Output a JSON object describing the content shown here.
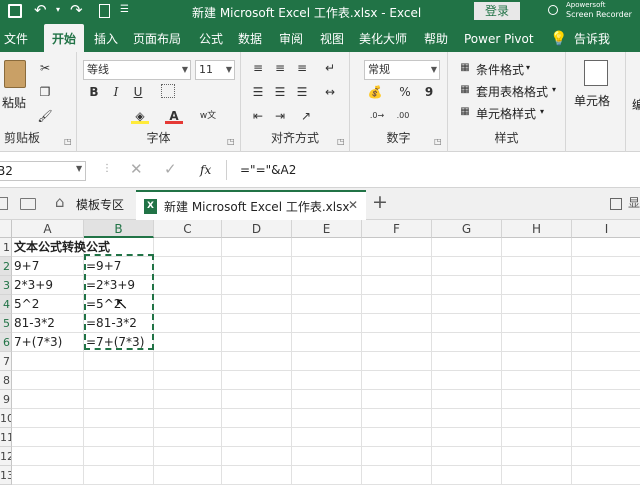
{
  "titlebar": {
    "save_icon": "save-icon",
    "undo_icon": "undo-icon",
    "redo_icon": "redo-icon",
    "title": "新建 Microsoft Excel 工作表.xlsx  -  Excel",
    "login": "登录",
    "recorder_line1": "Apowersoft",
    "recorder_line2": "Screen Recorder"
  },
  "menu": {
    "tabs": [
      "文件",
      "开始",
      "插入",
      "页面布局",
      "公式",
      "数据",
      "审阅",
      "视图",
      "美化大师",
      "帮助",
      "Power Pivot"
    ],
    "active": "开始",
    "tell_me": "告诉我"
  },
  "ribbon": {
    "clipboard": {
      "paste": "粘贴",
      "label": "剪贴板"
    },
    "font": {
      "name": "等线",
      "size": "11",
      "label": "字体",
      "bold": "B",
      "italic": "I",
      "underline": "U"
    },
    "alignment": {
      "label": "对齐方式"
    },
    "number": {
      "format": "常规",
      "percent": "%",
      "comma": "9",
      "label": "数字"
    },
    "styles": {
      "conditional": "条件格式",
      "table": "套用表格格式",
      "cell": "单元格样式",
      "label": "样式"
    },
    "cells": {
      "label": "单元格"
    }
  },
  "formula_bar": {
    "name_box": "B2",
    "fx": "fx",
    "formula": "=\"=\"&A2"
  },
  "workbook_tabs": {
    "template_tab": "模板专区",
    "file_tab": "新建 Microsoft Excel 工作表.xlsx",
    "add": "+"
  },
  "sheet": {
    "columns": [
      "A",
      "B",
      "C",
      "D",
      "E",
      "F",
      "G",
      "H",
      "I"
    ],
    "rows": [
      "1",
      "2",
      "3",
      "4",
      "5",
      "6",
      "7",
      "8",
      "9",
      "10",
      "11",
      "12",
      "13"
    ],
    "header_cell": "文本公式转换公式",
    "col_a": [
      "9+7",
      "2*3+9",
      "5^2",
      "81-3*2",
      "7+(7*3)"
    ],
    "col_b": [
      "=9+7",
      "=2*3+9",
      "=5^2",
      "=81-3*2",
      "=7+(7*3)"
    ]
  },
  "colors": {
    "excel_green": "#217346",
    "ribbon_bg": "#f3f3f3"
  }
}
